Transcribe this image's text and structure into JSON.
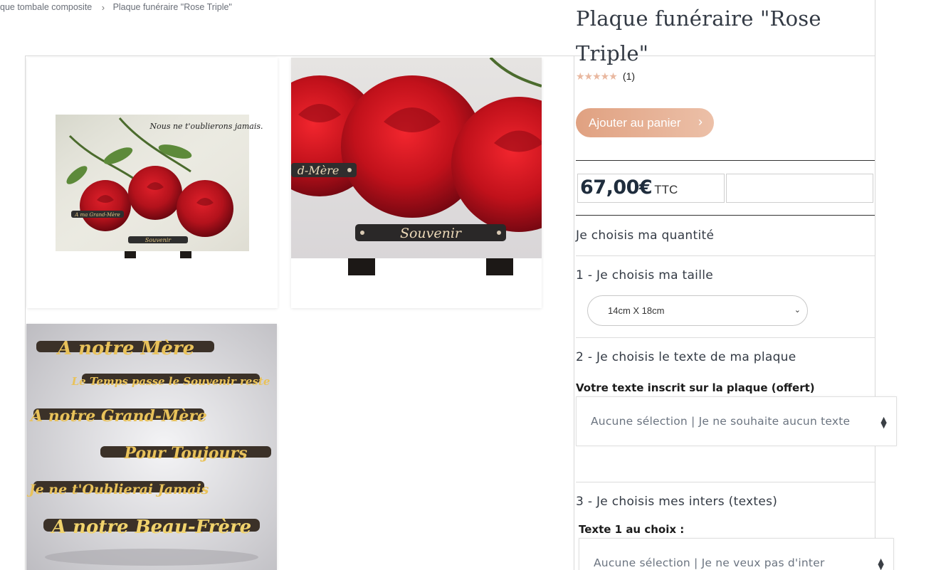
{
  "breadcrumb": {
    "items": [
      "que tombale composite",
      "Plaque funéraire \"Rose Triple\""
    ]
  },
  "gallery": {
    "image1": {
      "caption_text": "Nous ne t'oublierons jamais.",
      "plate_left": "A ma Grand-Mère",
      "plate_bottom": "Souvenir"
    },
    "image2": {
      "plate_left": "d-Mère",
      "plate_bottom": "Souvenir"
    },
    "image3": {
      "plates": [
        "A notre Mère",
        "Le Temps passe le Souvenir reste",
        "A notre Grand-Mère",
        "Pour Toujours",
        "Je ne t'Oublierai Jamais",
        "A notre Beau-Frère"
      ]
    }
  },
  "product": {
    "title": "Plaque funéraire \"Rose Triple\"",
    "stars": "★★★★★",
    "review_count": "(1)",
    "add_to_cart": "Ajouter au panier",
    "price": "67,00€",
    "price_suffix": "TTC"
  },
  "options": {
    "quantity_label": "Je choisis ma quantité",
    "size_label": "1 - Je choisis ma taille",
    "size_value": "14cm X 18cm",
    "text_label": "2 - Je choisis le texte de ma plaque",
    "text_field_label": "Votre texte inscrit sur la plaque (offert)",
    "text_value": "Aucune sélection | Je ne souhaite aucun texte",
    "inters_label": "3 - Je choisis mes inters (textes)",
    "inter1_label": "Texte 1 au choix :",
    "inter1_value": "Aucune sélection | Je ne veux pas d'inter"
  },
  "colors": {
    "accent": "#e0a181",
    "star": "#e9b8a0",
    "title": "#333a44",
    "price": "#1f2d3d"
  }
}
